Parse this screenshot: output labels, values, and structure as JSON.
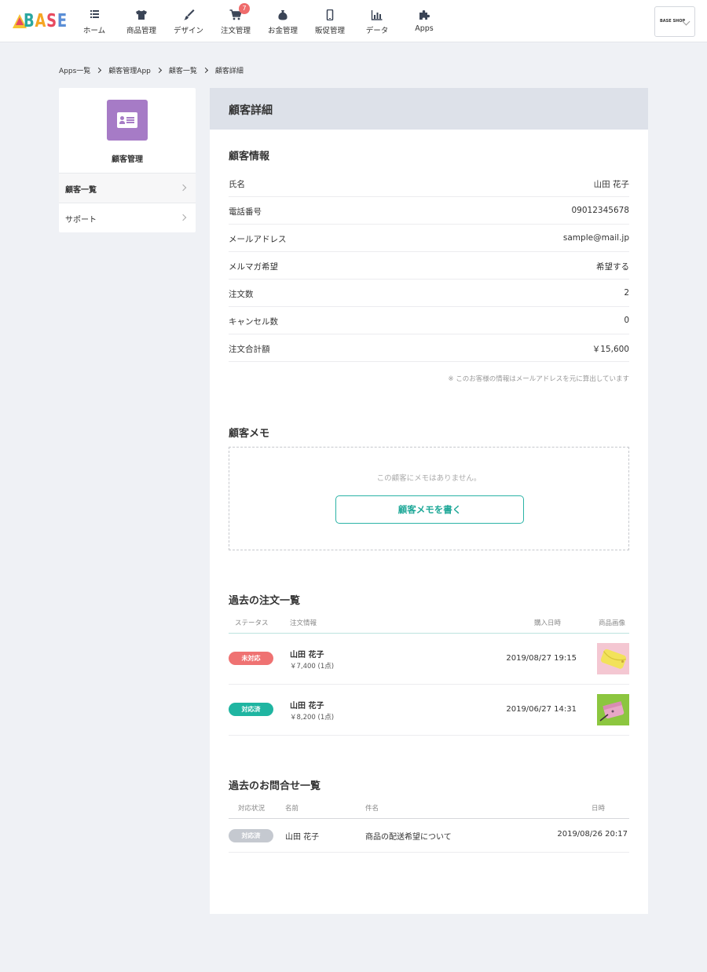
{
  "header": {
    "logo_text": "BASE",
    "nav": [
      {
        "label": "ホーム",
        "icon": "list-icon"
      },
      {
        "label": "商品管理",
        "icon": "shirt-icon"
      },
      {
        "label": "デザイン",
        "icon": "brush-icon"
      },
      {
        "label": "注文管理",
        "icon": "cart-icon",
        "badge": "7"
      },
      {
        "label": "お金管理",
        "icon": "money-bag-icon"
      },
      {
        "label": "販促管理",
        "icon": "smartphone-icon"
      },
      {
        "label": "データ",
        "icon": "bar-chart-icon"
      },
      {
        "label": "Apps",
        "icon": "puzzle-icon"
      }
    ],
    "shop_name": "BASE SHOP"
  },
  "breadcrumb": [
    "Apps一覧",
    "顧客管理App",
    "顧客一覧",
    "顧客詳細"
  ],
  "sidebar": {
    "app_name": "顧客管理",
    "items": [
      {
        "label": "顧客一覧",
        "active": true
      },
      {
        "label": "サポート",
        "active": false
      }
    ]
  },
  "main": {
    "title": "顧客詳細",
    "customer_info": {
      "title": "顧客情報",
      "rows": [
        {
          "label": "氏名",
          "value": "山田 花子"
        },
        {
          "label": "電話番号",
          "value": "09012345678"
        },
        {
          "label": "メールアドレス",
          "value": "sample@mail.jp"
        },
        {
          "label": "メルマガ希望",
          "value": "希望する"
        },
        {
          "label": "注文数",
          "value": "2"
        },
        {
          "label": "キャンセル数",
          "value": "0"
        },
        {
          "label": "注文合計額",
          "value": "￥15,600"
        }
      ],
      "note": "※ このお客様の情報はメールアドレスを元に算出しています"
    },
    "memo": {
      "title": "顧客メモ",
      "empty_text": "この顧客にメモはありません。",
      "button_label": "顧客メモを書く"
    },
    "orders": {
      "title": "過去の注文一覧",
      "headers": [
        "ステータス",
        "注文情報",
        "購入日時",
        "商品画像"
      ],
      "rows": [
        {
          "status": "未対応",
          "status_color": "#ef7272",
          "name": "山田 花子",
          "price": "￥7,400 (1点)",
          "date": "2019/08/27 19:15",
          "image": "yellow-wallet-image"
        },
        {
          "status": "対応済",
          "status_color": "#1fb5a1",
          "name": "山田 花子",
          "price": "￥8,200 (1点)",
          "date": "2019/06/27 14:31",
          "image": "pink-pouch-image"
        }
      ]
    },
    "inquiries": {
      "title": "過去のお問合せ一覧",
      "headers": [
        "対応状況",
        "名前",
        "件名",
        "日時"
      ],
      "rows": [
        {
          "status": "対応済",
          "status_color": "#c5c9d0",
          "name": "山田 花子",
          "subject": "商品の配送希望について",
          "date": "2019/08/26 20:17"
        }
      ]
    }
  },
  "colors": {
    "accent": "#2bb3a6",
    "app_icon": "#a67bc6",
    "page_bg": "#eff1f5",
    "header_bg": "#dde1e9",
    "badge": "#ef6b6b"
  }
}
